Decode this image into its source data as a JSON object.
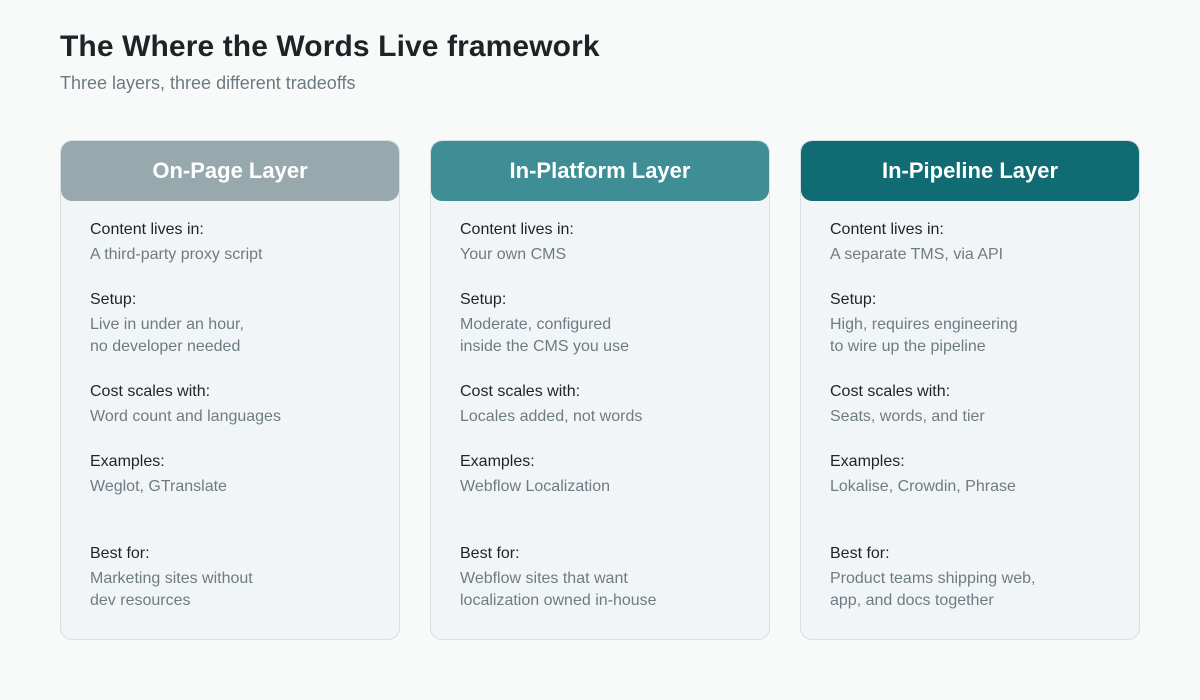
{
  "title": "The Where the Words Live framework",
  "subtitle": "Three layers, three different tradeoffs",
  "labels": {
    "content": "Content lives in:",
    "setup": "Setup:",
    "cost": "Cost scales with:",
    "examples": "Examples:",
    "best": "Best for:"
  },
  "header_colors": [
    "#97a9ad",
    "#3f8d95",
    "#106b72"
  ],
  "cards": [
    {
      "title": "On-Page Layer",
      "content": "A third-party proxy script",
      "setup": "Live in under an hour,\nno developer needed",
      "cost": "Word count and languages",
      "examples": "Weglot, GTranslate",
      "best": "Marketing sites without\ndev resources"
    },
    {
      "title": "In-Platform Layer",
      "content": "Your own CMS",
      "setup": "Moderate, configured\ninside the CMS you use",
      "cost": "Locales added, not words",
      "examples": "Webflow Localization",
      "best": "Webflow sites that want\nlocalization owned in-house"
    },
    {
      "title": "In-Pipeline Layer",
      "content": "A separate TMS, via API",
      "setup": "High, requires engineering\nto wire up the pipeline",
      "cost": "Seats, words, and tier",
      "examples": "Lokalise, Crowdin, Phrase",
      "best": "Product teams shipping web,\napp, and docs together"
    }
  ]
}
